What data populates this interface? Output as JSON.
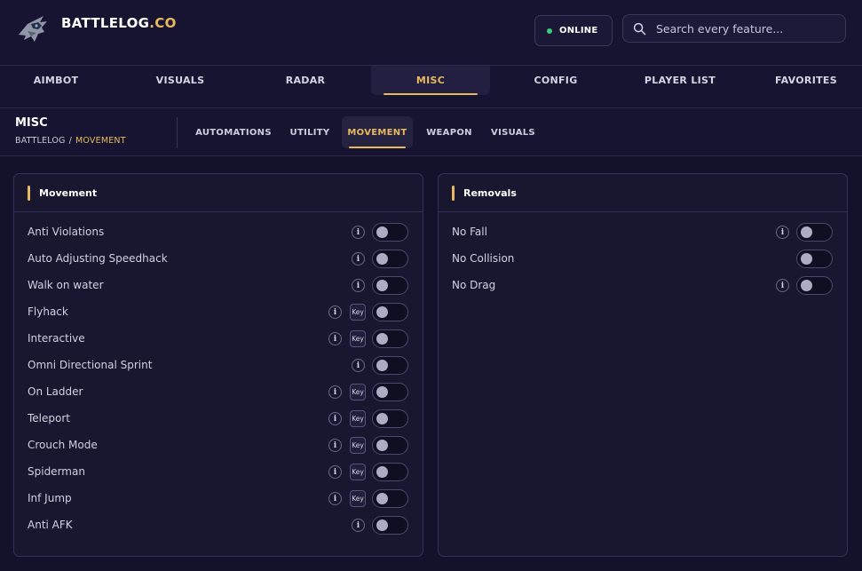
{
  "header": {
    "brand_main": "BATTLELOG",
    "brand_accent": ".CO",
    "logo_icon": "falcon-logo-icon",
    "status": "ONLINE",
    "status_color": "#3ad07a",
    "search_placeholder": "Search every feature..."
  },
  "nav": {
    "tabs": [
      {
        "label": "AIMBOT"
      },
      {
        "label": "VISUALS"
      },
      {
        "label": "RADAR"
      },
      {
        "label": "MISC",
        "active": true
      },
      {
        "label": "CONFIG"
      },
      {
        "label": "PLAYER LIST"
      },
      {
        "label": "FAVORITES"
      }
    ]
  },
  "section": {
    "title": "MISC",
    "breadcrumb_root": "BATTLELOG",
    "breadcrumb_sep": "/",
    "breadcrumb_current": "MOVEMENT"
  },
  "subnav": {
    "tabs": [
      {
        "label": "AUTOMATIONS"
      },
      {
        "label": "UTILITY"
      },
      {
        "label": "MOVEMENT",
        "active": true
      },
      {
        "label": "WEAPON"
      },
      {
        "label": "VISUALS"
      }
    ]
  },
  "panels": {
    "movement": {
      "title": "Movement",
      "rows": [
        {
          "label": "Anti Violations",
          "info": true,
          "key": false,
          "enabled": false
        },
        {
          "label": "Auto Adjusting Speedhack",
          "info": true,
          "key": false,
          "enabled": false
        },
        {
          "label": "Walk on water",
          "info": true,
          "key": false,
          "enabled": false
        },
        {
          "label": "Flyhack",
          "info": true,
          "key": true,
          "enabled": false
        },
        {
          "label": "Interactive",
          "info": true,
          "key": true,
          "enabled": false
        },
        {
          "label": "Omni Directional Sprint",
          "info": true,
          "key": false,
          "enabled": false
        },
        {
          "label": "On Ladder",
          "info": true,
          "key": true,
          "enabled": false
        },
        {
          "label": "Teleport",
          "info": true,
          "key": true,
          "enabled": false
        },
        {
          "label": "Crouch Mode",
          "info": true,
          "key": true,
          "enabled": false
        },
        {
          "label": "Spiderman",
          "info": true,
          "key": true,
          "enabled": false
        },
        {
          "label": "Inf Jump",
          "info": true,
          "key": true,
          "enabled": false
        },
        {
          "label": "Anti AFK",
          "info": true,
          "key": false,
          "enabled": false
        }
      ]
    },
    "removals": {
      "title": "Removals",
      "rows": [
        {
          "label": "No Fall",
          "info": true,
          "key": false,
          "enabled": false
        },
        {
          "label": "No Collision",
          "info": false,
          "key": false,
          "enabled": false
        },
        {
          "label": "No Drag",
          "info": true,
          "key": false,
          "enabled": false
        }
      ]
    }
  },
  "labels": {
    "info": "i",
    "key": "Key"
  },
  "colors": {
    "accent": "#e8b960",
    "background": "#14122a",
    "panel": "#19172f"
  }
}
